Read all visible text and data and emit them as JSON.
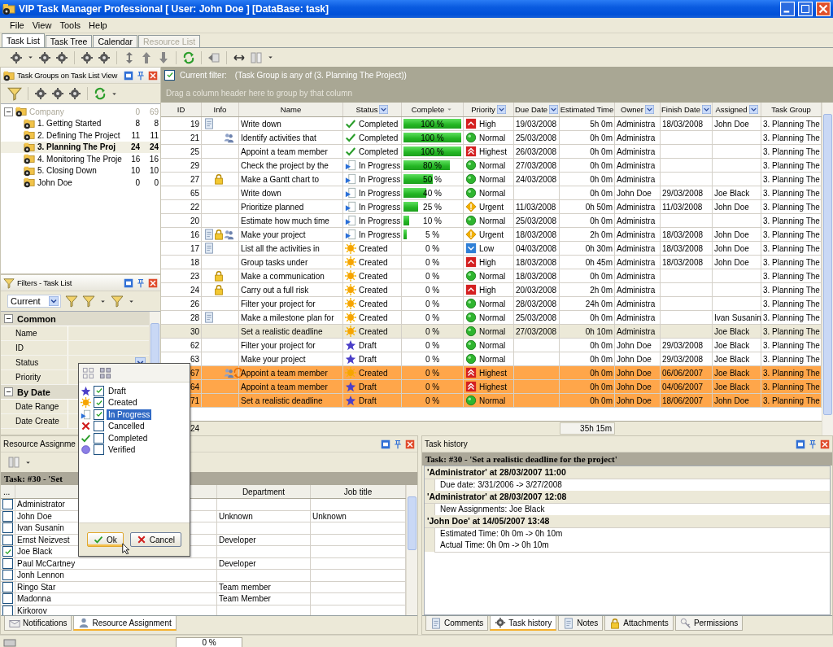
{
  "window": {
    "title": "VIP Task Manager Professional [ User: John Doe ] [DataBase: task]"
  },
  "menu": [
    "File",
    "View",
    "Tools",
    "Help"
  ],
  "tabs": [
    {
      "label": "Task List",
      "selected": true,
      "disabled": false
    },
    {
      "label": "Task Tree",
      "selected": false,
      "disabled": false
    },
    {
      "label": "Calendar",
      "selected": false,
      "disabled": false
    },
    {
      "label": "Resource List",
      "selected": false,
      "disabled": true
    }
  ],
  "task_groups": {
    "title": "Task Groups on Task List View",
    "tree": [
      {
        "label": "Company",
        "count_1": "0",
        "count_2": "69",
        "selected": false,
        "disabled": true,
        "expanded": true,
        "children": [
          {
            "label": "1. Getting Started",
            "count_1": "8",
            "count_2": "8",
            "selected": false,
            "disabled": false
          },
          {
            "label": "2. Defining The Project",
            "count_1": "11",
            "count_2": "11",
            "selected": false,
            "disabled": false
          },
          {
            "label": "3. Planning The Proj",
            "count_1": "24",
            "count_2": "24",
            "selected": true,
            "disabled": false
          },
          {
            "label": "4. Monitoring The Proje",
            "count_1": "16",
            "count_2": "16",
            "selected": false,
            "disabled": false
          },
          {
            "label": "5. Closing Down",
            "count_1": "10",
            "count_2": "10",
            "selected": false,
            "disabled": false
          },
          {
            "label": "John Doe",
            "count_1": "0",
            "count_2": "0",
            "selected": false,
            "disabled": false
          }
        ]
      }
    ]
  },
  "filters": {
    "title": "Filters - Task List",
    "preset": "Current",
    "categories": [
      {
        "label": "Common",
        "expanded": true,
        "properties": [
          {
            "label": "Name",
            "dropdown": false
          },
          {
            "label": "ID",
            "dropdown": false
          },
          {
            "label": "Status",
            "dropdown": true
          },
          {
            "label": "Priority",
            "dropdown": false
          }
        ]
      },
      {
        "label": "By Date",
        "expanded": true,
        "properties": [
          {
            "label": "Date Range",
            "dropdown": false
          },
          {
            "label": "Date Create",
            "dropdown": false
          }
        ]
      }
    ]
  },
  "task_list": {
    "filter": {
      "enabled": true,
      "label": "Current filter:",
      "text": "(Task Group is any of (3. Planning The Project))"
    },
    "group_hint": "Drag a column header here to group by that column",
    "columns": [
      {
        "label": "ID",
        "kind": "plain"
      },
      {
        "label": "Info",
        "kind": "plain"
      },
      {
        "label": "Name",
        "kind": "plain"
      },
      {
        "label": "Status",
        "kind": "dropdown"
      },
      {
        "label": "Complete",
        "kind": "faded"
      },
      {
        "label": "Priority",
        "kind": "dropdown"
      },
      {
        "label": "Due Date",
        "kind": "dropdown"
      },
      {
        "label": "Estimated Time",
        "kind": "plain"
      },
      {
        "label": "Owner",
        "kind": "dropdown"
      },
      {
        "label": "Finish Date",
        "kind": "dropdown"
      },
      {
        "label": "Assigned",
        "kind": "dropdown"
      },
      {
        "label": "Task Group",
        "kind": "plain"
      }
    ],
    "rows": [
      {
        "id": "19",
        "info": [
          {
            "kind": "note"
          }
        ],
        "name": "Write down",
        "status": {
          "kind": "completed",
          "label": "Completed"
        },
        "complete": "100 %",
        "level": 1,
        "priority": {
          "kind": "high",
          "label": "High"
        },
        "due": "19/03/2008",
        "estimated": "5h 0m",
        "owner": "Administra",
        "finish": "18/03/2008",
        "assigned": "John Doe",
        "group": "3. Planning The",
        "selected": false,
        "overdue": false
      },
      {
        "id": "21",
        "info": [
          {
            "kind": "assign"
          }
        ],
        "name": "Identify activities that",
        "status": {
          "kind": "completed",
          "label": "Completed"
        },
        "complete": "100 %",
        "level": 1,
        "priority": {
          "kind": "normal",
          "label": "Normal"
        },
        "due": "25/03/2008",
        "estimated": "0h 0m",
        "owner": "Administra",
        "group": "3. Planning The",
        "selected": false,
        "overdue": false
      },
      {
        "id": "25",
        "info": [],
        "name": "Appoint a team member",
        "status": {
          "kind": "completed",
          "label": "Completed"
        },
        "complete": "100 %",
        "level": 1,
        "priority": {
          "kind": "highest",
          "label": "Highest"
        },
        "due": "26/03/2008",
        "estimated": "0h 0m",
        "owner": "Administra",
        "group": "3. Planning The",
        "selected": false,
        "overdue": false
      },
      {
        "id": "29",
        "info": [],
        "name": "Check the project by the",
        "status": {
          "kind": "in_progress",
          "label": "In Progress"
        },
        "complete": "80 %",
        "level": 0.8,
        "priority": {
          "kind": "normal",
          "label": "Normal"
        },
        "due": "27/03/2008",
        "estimated": "0h 0m",
        "owner": "Administra",
        "group": "3. Planning The",
        "selected": false,
        "overdue": false
      },
      {
        "id": "27",
        "info": [
          {
            "kind": "lock"
          }
        ],
        "name": "Make a Gantt chart to",
        "status": {
          "kind": "in_progress",
          "label": "In Progress"
        },
        "complete": "50 %",
        "level": 0.5,
        "priority": {
          "kind": "normal",
          "label": "Normal"
        },
        "due": "24/03/2008",
        "estimated": "0h 0m",
        "owner": "Administra",
        "group": "3. Planning The",
        "selected": false,
        "overdue": false
      },
      {
        "id": "65",
        "info": [],
        "name": "Write down",
        "status": {
          "kind": "in_progress",
          "label": "In Progress"
        },
        "complete": "40 %",
        "level": 0.4,
        "priority": {
          "kind": "normal",
          "label": "Normal"
        },
        "estimated": "0h 0m",
        "owner": "John Doe",
        "finish": "29/03/2008",
        "assigned": "Joe Black",
        "group": "3. Planning The",
        "selected": false,
        "overdue": false
      },
      {
        "id": "22",
        "info": [],
        "name": "Prioritize planned",
        "status": {
          "kind": "in_progress",
          "label": "In Progress"
        },
        "complete": "25 %",
        "level": 0.25,
        "priority": {
          "kind": "urgent",
          "label": "Urgent"
        },
        "due": "11/03/2008",
        "estimated": "0h 50m",
        "owner": "Administra",
        "finish": "11/03/2008",
        "assigned": "John Doe",
        "group": "3. Planning The",
        "selected": false,
        "overdue": false
      },
      {
        "id": "20",
        "info": [],
        "name": "Estimate how much time",
        "status": {
          "kind": "in_progress",
          "label": "In Progress"
        },
        "complete": "10 %",
        "level": 0.1,
        "priority": {
          "kind": "normal",
          "label": "Normal"
        },
        "due": "25/03/2008",
        "estimated": "0h 0m",
        "owner": "Administra",
        "group": "3. Planning The",
        "selected": false,
        "overdue": false
      },
      {
        "id": "16",
        "info": [
          {
            "kind": "note"
          },
          {
            "kind": "lock"
          },
          {
            "kind": "assign"
          }
        ],
        "name": "Make your project",
        "status": {
          "kind": "in_progress",
          "label": "In Progress"
        },
        "complete": "5 %",
        "level": 0.05,
        "priority": {
          "kind": "urgent",
          "label": "Urgent"
        },
        "due": "18/03/2008",
        "estimated": "2h 0m",
        "owner": "Administra",
        "finish": "18/03/2008",
        "assigned": "John Doe",
        "group": "3. Planning The",
        "selected": false,
        "overdue": false
      },
      {
        "id": "17",
        "info": [
          {
            "kind": "note"
          }
        ],
        "name": "List all the activities in",
        "status": {
          "kind": "created",
          "label": "Created"
        },
        "complete": "0 %",
        "priority": {
          "kind": "low",
          "label": "Low"
        },
        "due": "04/03/2008",
        "estimated": "0h 30m",
        "owner": "Administra",
        "finish": "18/03/2008",
        "assigned": "John Doe",
        "group": "3. Planning The",
        "selected": false,
        "overdue": false
      },
      {
        "id": "18",
        "info": [],
        "name": "Group tasks under",
        "status": {
          "kind": "created",
          "label": "Created"
        },
        "complete": "0 %",
        "priority": {
          "kind": "high",
          "label": "High"
        },
        "due": "18/03/2008",
        "estimated": "0h 45m",
        "owner": "Administra",
        "finish": "18/03/2008",
        "assigned": "John Doe",
        "group": "3. Planning The",
        "selected": false,
        "overdue": false
      },
      {
        "id": "23",
        "info": [
          {
            "kind": "lock"
          }
        ],
        "name": "Make a communication",
        "status": {
          "kind": "created",
          "label": "Created"
        },
        "complete": "0 %",
        "priority": {
          "kind": "normal",
          "label": "Normal"
        },
        "due": "18/03/2008",
        "estimated": "0h 0m",
        "owner": "Administra",
        "group": "3. Planning The",
        "selected": false,
        "overdue": false
      },
      {
        "id": "24",
        "info": [
          {
            "kind": "lock"
          }
        ],
        "name": "Carry out a full risk",
        "status": {
          "kind": "created",
          "label": "Created"
        },
        "complete": "0 %",
        "priority": {
          "kind": "high",
          "label": "High"
        },
        "due": "20/03/2008",
        "estimated": "2h 0m",
        "owner": "Administra",
        "group": "3. Planning The",
        "selected": false,
        "overdue": false
      },
      {
        "id": "26",
        "info": [],
        "name": "Filter your project for",
        "status": {
          "kind": "created",
          "label": "Created"
        },
        "complete": "0 %",
        "priority": {
          "kind": "normal",
          "label": "Normal"
        },
        "due": "28/03/2008",
        "estimated": "24h 0m",
        "owner": "Administra",
        "group": "3. Planning The",
        "selected": false,
        "overdue": false
      },
      {
        "id": "28",
        "info": [
          {
            "kind": "note"
          }
        ],
        "name": "Make a milestone plan for",
        "status": {
          "kind": "created",
          "label": "Created"
        },
        "complete": "0 %",
        "priority": {
          "kind": "normal",
          "label": "Normal"
        },
        "due": "25/03/2008",
        "estimated": "0h 0m",
        "owner": "Administra",
        "assigned": "Ivan Susanin",
        "group": "3. Planning The",
        "selected": false,
        "overdue": false
      },
      {
        "id": "30",
        "info": [],
        "name": "Set a realistic deadline",
        "status": {
          "kind": "created",
          "label": "Created"
        },
        "complete": "0 %",
        "priority": {
          "kind": "normal",
          "label": "Normal"
        },
        "due": "27/03/2008",
        "estimated": "0h 10m",
        "owner": "Administra",
        "assigned": "Joe Black",
        "group": "3. Planning The",
        "selected": true,
        "overdue": false
      },
      {
        "id": "62",
        "info": [],
        "name": "Filter your project for",
        "status": {
          "kind": "draft",
          "label": "Draft"
        },
        "complete": "0 %",
        "priority": {
          "kind": "normal",
          "label": "Normal"
        },
        "estimated": "0h 0m",
        "owner": "John Doe",
        "finish": "29/03/2008",
        "assigned": "Joe Black",
        "group": "3. Planning The",
        "selected": false,
        "overdue": false
      },
      {
        "id": "63",
        "info": [],
        "name": "Make your project",
        "status": {
          "kind": "draft",
          "label": "Draft"
        },
        "complete": "0 %",
        "priority": {
          "kind": "normal",
          "label": "Normal"
        },
        "estimated": "0h 0m",
        "owner": "John Doe",
        "finish": "29/03/2008",
        "assigned": "Joe Black",
        "group": "3. Planning The",
        "selected": false,
        "overdue": false
      },
      {
        "id": "67",
        "info": [
          {
            "kind": "assign"
          },
          {
            "kind": "recur"
          }
        ],
        "name": "Appoint a team member",
        "status": {
          "kind": "created",
          "label": "Created"
        },
        "complete": "0 %",
        "priority": {
          "kind": "highest",
          "label": "Highest"
        },
        "estimated": "0h 0m",
        "owner": "John Doe",
        "finish": "06/06/2007",
        "assigned": "Joe Black",
        "group": "3. Planning The",
        "selected": false,
        "overdue": true
      },
      {
        "id": "64",
        "info": [],
        "name": "Appoint a team member",
        "status": {
          "kind": "draft",
          "label": "Draft"
        },
        "complete": "0 %",
        "priority": {
          "kind": "highest",
          "label": "Highest"
        },
        "estimated": "0h 0m",
        "owner": "John Doe",
        "finish": "04/06/2007",
        "assigned": "Joe Black",
        "group": "3. Planning The",
        "selected": false,
        "overdue": true
      },
      {
        "id": "71",
        "info": [],
        "name": "Set a realistic deadline",
        "status": {
          "kind": "draft",
          "label": "Draft"
        },
        "complete": "0 %",
        "priority": {
          "kind": "normal",
          "label": "Normal"
        },
        "estimated": "0h 0m",
        "owner": "John Doe",
        "finish": "18/06/2007",
        "assigned": "John Doe",
        "group": "3. Planning The",
        "selected": false,
        "overdue": true
      }
    ],
    "footer": {
      "count": "24",
      "estimated_total": "35h 15m"
    }
  },
  "status_popup": {
    "options": [
      {
        "kind": "draft",
        "label": "Draft",
        "checked": true,
        "selected": false
      },
      {
        "kind": "created",
        "label": "Created",
        "checked": true,
        "selected": false
      },
      {
        "kind": "in_progress",
        "label": "In Progress",
        "checked": true,
        "selected": true
      },
      {
        "kind": "cancelled",
        "label": "Cancelled",
        "checked": false,
        "selected": false
      },
      {
        "kind": "completed",
        "label": "Completed",
        "checked": false,
        "selected": false
      },
      {
        "kind": "verified",
        "label": "Verified",
        "checked": false,
        "selected": false
      }
    ],
    "ok": "Ok",
    "cancel": "Cancel"
  },
  "resource_assignment": {
    "title": "Resource Assignme",
    "task": "Task: #30 - 'Set",
    "columns": [
      "...",
      "Department",
      "Job title"
    ],
    "rows": [
      {
        "name": "Administrator",
        "checked": false
      },
      {
        "name": "John Doe",
        "checked": false,
        "department": "Unknown",
        "job_title": "Unknown"
      },
      {
        "name": "Ivan Susanin",
        "checked": false
      },
      {
        "name": "Ernst Neizvest",
        "checked": false,
        "department": "Developer"
      },
      {
        "name": "Joe Black",
        "checked": true
      },
      {
        "name": "Paul McCartney",
        "checked": false,
        "department": "Developer"
      },
      {
        "name": "Jonh Lennon",
        "checked": false
      },
      {
        "name": "Ringo Star",
        "checked": false,
        "department": "Team member"
      },
      {
        "name": "Madonna",
        "checked": false,
        "department": "Team Member"
      },
      {
        "name": "Kirkorov",
        "checked": false
      }
    ]
  },
  "task_history": {
    "title": "Task history",
    "task": "Task: #30 - 'Set a realistic deadline for the project'",
    "entries": [
      {
        "header": "'Administrator' at 28/03/2007 11:00",
        "changes": [
          "Due date: 3/31/2006 -> 3/27/2008"
        ]
      },
      {
        "header": "'Administrator' at 28/03/2007 12:08",
        "changes": [
          "New Assignments: Joe Black"
        ]
      },
      {
        "header": "'John Doe' at 14/05/2007 13:48",
        "changes": [
          "Estimated Time: 0h 0m -> 0h 10m",
          "Actual Time: 0h 0m -> 0h 10m"
        ]
      }
    ]
  },
  "bottom_tabs_left": [
    {
      "kind": "notifications",
      "label": "Notifications",
      "selected": false
    },
    {
      "kind": "resources",
      "label": "Resource Assignment",
      "selected": true
    }
  ],
  "bottom_tabs_right": [
    {
      "kind": "comments",
      "label": "Comments",
      "selected": false
    },
    {
      "kind": "history",
      "label": "Task history",
      "selected": true
    },
    {
      "kind": "notes",
      "label": "Notes",
      "selected": false
    },
    {
      "kind": "attachments",
      "label": "Attachments",
      "selected": false
    },
    {
      "kind": "permissions",
      "label": "Permissions",
      "selected": false
    }
  ],
  "status_bar": {
    "progress": "0 %"
  }
}
